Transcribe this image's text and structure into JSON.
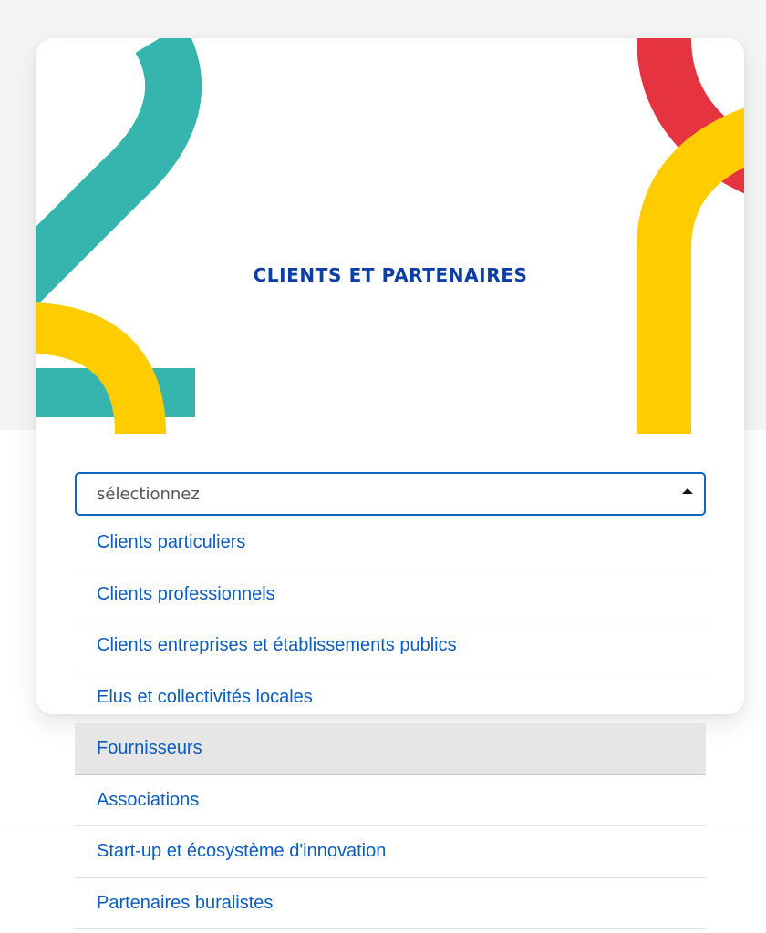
{
  "card": {
    "title": "CLIENTS ET PARTENAIRES"
  },
  "colors": {
    "teal": "#35b5ad",
    "yellow": "#ffcc00",
    "red": "#e63340",
    "title_blue": "#0b3ea8",
    "option_blue": "#0b5cc0",
    "select_border": "#1565c0",
    "highlight_bg": "#e6e6e6"
  },
  "select": {
    "placeholder": "sélectionnez",
    "caret_icon": "caret-up-icon",
    "options": [
      {
        "label": "Clients particuliers"
      },
      {
        "label": "Clients professionnels"
      },
      {
        "label": "Clients entreprises et établissements publics"
      },
      {
        "label": "Elus et collectivités locales"
      },
      {
        "label": "Fournisseurs",
        "highlighted": true
      },
      {
        "label": "Associations"
      },
      {
        "label": "Start-up et écosystème d'innovation"
      },
      {
        "label": "Partenaires buralistes"
      }
    ]
  }
}
